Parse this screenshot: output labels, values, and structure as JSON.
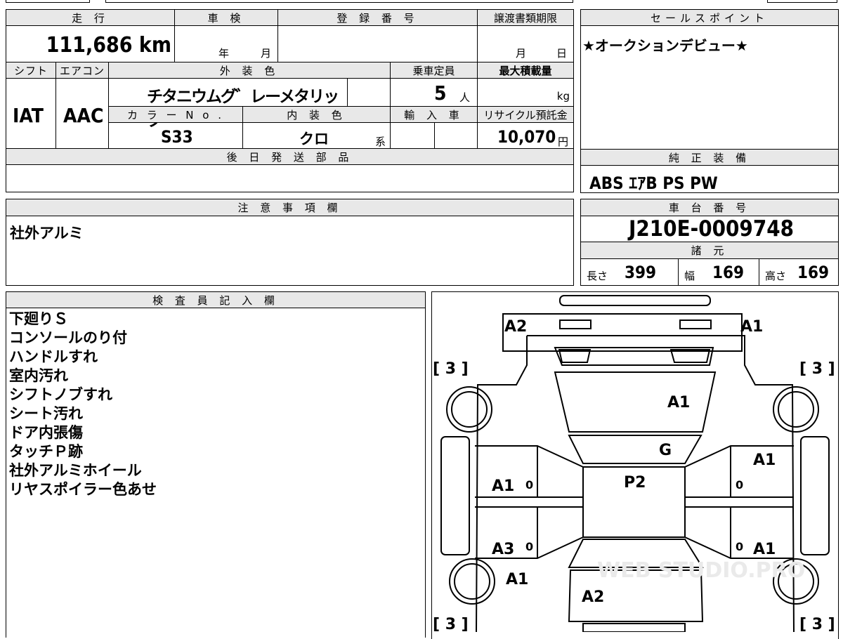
{
  "top": {
    "mileage_label": "走 行",
    "mileage_value": "111,686 km",
    "inspection_label": "車 検",
    "inspection_year": "年",
    "inspection_month": "月",
    "reg_label": "登 録 番 号",
    "transfer_label": "譲渡書類期限",
    "transfer_month": "月",
    "transfer_day": "日",
    "shift_label": "シフト",
    "shift_value": "IAT",
    "ac_label": "エアコン",
    "ac_value": "AAC",
    "exterior_label": "外 装 色",
    "exterior_value": "チタニウムグ゛レーメタリック",
    "capacity_label": "乗車定員",
    "capacity_value": "5",
    "capacity_unit": "人",
    "maxload_label": "最大積載量",
    "maxload_unit": "kg",
    "color_no_label": "カ ラ ー N o .",
    "color_no_value": "S33",
    "interior_label": "内 装 色",
    "interior_value": "クロ",
    "interior_suffix": "系",
    "import_label": "輸 入 車",
    "recycle_label": "リサイクル預託金",
    "recycle_value": "10,070",
    "recycle_unit": "円",
    "later_parts_label": "後 日 発 送 部 品"
  },
  "sales": {
    "label": "セールスポイント",
    "text": "★オークションデビュー★",
    "equipment_label": "純 正 装 備",
    "equipment_value": "ABS ｴｱB PS PW"
  },
  "notes": {
    "label": "注 意 事 項 欄",
    "text": "社外アルミ"
  },
  "chassis": {
    "label": "車 台 番 号",
    "value": "J210E-0009748",
    "spec_label": "諸 元",
    "length_label": "長さ",
    "length_value": "399",
    "width_label": "幅",
    "width_value": "169",
    "height_label": "高さ",
    "height_value": "169"
  },
  "inspector": {
    "label": "検 査 員 記 入 欄",
    "lines": [
      "下廻りＳ",
      "コンソールのり付",
      "ハンドルすれ",
      "室内汚れ",
      "シフトノブすれ",
      "シート汚れ",
      "ドア内張傷",
      "タッチＰ跡",
      "社外アルミホイール",
      "リヤスポイラー色あせ"
    ]
  },
  "diagram": {
    "front_left": "A2",
    "front_right": "A1",
    "tire_tl": "[ 3 ]",
    "tire_tr": "[ 3 ]",
    "tire_bl": "[ 3 ]",
    "tire_br": "[ 3 ]",
    "hood": "A1",
    "glass": "G",
    "roof": "P2",
    "right_front_fender": "A1",
    "left_front_door": "A1",
    "left_front_door_num": "0",
    "right_front_door_num": "0",
    "left_rear_door": "A3",
    "left_rear_door_num": "0",
    "right_rear_door": "A1",
    "right_rear_door_num": "0",
    "left_rear_fender": "A1",
    "rear": "A2",
    "watermark": "WEB STUDIO.PRO"
  }
}
